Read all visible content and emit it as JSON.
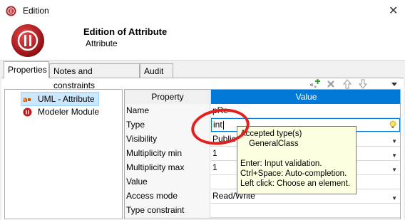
{
  "window": {
    "title": "Edition",
    "close_glyph": "✕"
  },
  "header": {
    "title": "Edition of Attribute",
    "subtitle": "Attribute"
  },
  "tabs": [
    {
      "label": "Properties",
      "active": true
    },
    {
      "label": "Notes and constraints",
      "active": false
    },
    {
      "label": "Audit",
      "active": false
    }
  ],
  "toolbar": {
    "icons": [
      "add-element-icon",
      "delete-icon",
      "move-up-icon",
      "move-down-icon",
      "menu-dropdown-icon"
    ]
  },
  "tree": {
    "items": [
      {
        "label": "UML - Attribute",
        "icon": "attribute-icon",
        "selected": true
      },
      {
        "label": "Modeler Module",
        "icon": "module-icon",
        "selected": false
      }
    ]
  },
  "grid": {
    "headers": {
      "property": "Property",
      "value": "Value"
    },
    "rows": [
      {
        "property": "Name",
        "value": "pRe",
        "dropdown": false
      },
      {
        "property": "Type",
        "value": "int",
        "dropdown": false,
        "editing": true
      },
      {
        "property": "Visibility",
        "value": "Public",
        "dropdown": true
      },
      {
        "property": "Multiplicity min",
        "value": "1",
        "dropdown": true
      },
      {
        "property": "Multiplicity max",
        "value": "1",
        "dropdown": true
      },
      {
        "property": "Value",
        "value": "",
        "dropdown": false
      },
      {
        "property": "Access mode",
        "value": "Read/Write",
        "dropdown": true
      },
      {
        "property": "Type constraint",
        "value": "",
        "dropdown": false
      }
    ]
  },
  "tooltip": {
    "line1": "Accepted type(s)",
    "line2": "GeneralClass",
    "line3": "Enter: Input validation.",
    "line4": "Ctrl+Space: Auto-completion.",
    "line5": "Left click: Choose an element."
  },
  "colors": {
    "value_header": "#0078d7",
    "highlight_circle": "#e22020",
    "tooltip_bg": "#ffffe1"
  }
}
